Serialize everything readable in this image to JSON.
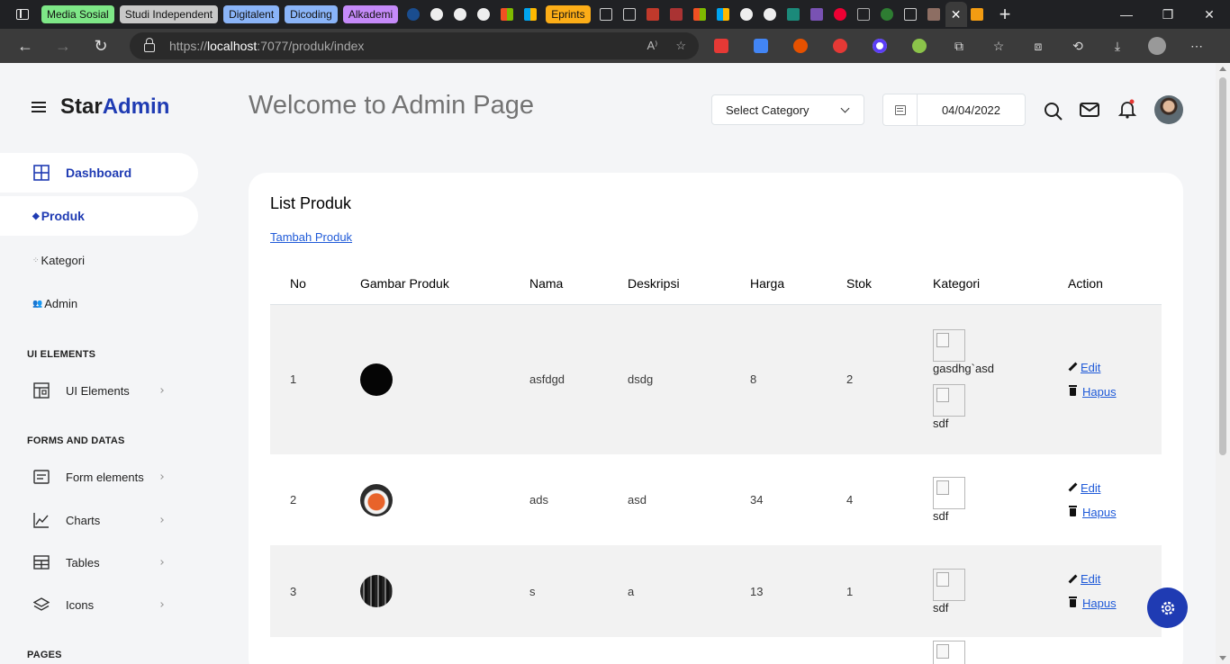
{
  "browser": {
    "tab_groups": [
      {
        "label": "Media Sosial",
        "color": "#7ee787"
      },
      {
        "label": "Studi Independent",
        "color": "#c8c8c8"
      },
      {
        "label": "Digitalent",
        "color": "#8ab4f8"
      },
      {
        "label": "Dicoding",
        "color": "#8ab4f8"
      },
      {
        "label": "Alkademi",
        "color": "#c58af9"
      },
      {
        "label": "Eprints",
        "color": "#fcad17"
      }
    ],
    "url_scheme": "https://",
    "url_host": "localhost",
    "url_rest": ":7077/produk/index"
  },
  "header": {
    "brand_star": "Star",
    "brand_admin": "Admin",
    "welcome": "Welcome to Admin Page",
    "category_select": "Select Category",
    "date": "04/04/2022"
  },
  "sidebar": {
    "dashboard": "Dashboard",
    "produk": "Produk",
    "kategori": "Kategori",
    "admin": "Admin",
    "section_ui": "UI ELEMENTS",
    "ui_elements": "UI Elements",
    "section_forms": "FORMS AND DATAS",
    "form_elements": "Form elements",
    "charts": "Charts",
    "tables": "Tables",
    "icons": "Icons",
    "section_pages": "PAGES"
  },
  "card": {
    "title": "List Produk",
    "add_link": "Tambah Produk",
    "columns": [
      "No",
      "Gambar Produk",
      "Nama",
      "Deskripsi",
      "Harga",
      "Stok",
      "Kategori",
      "Action"
    ],
    "rows": [
      {
        "no": "1",
        "nama": "asfdgd",
        "deskripsi": "dsdg",
        "harga": "8",
        "stok": "2",
        "kategori": [
          "gasdhg`asd",
          "sdf"
        ]
      },
      {
        "no": "2",
        "nama": "ads",
        "deskripsi": "asd",
        "harga": "34",
        "stok": "4",
        "kategori": [
          "sdf"
        ]
      },
      {
        "no": "3",
        "nama": "s",
        "deskripsi": "a",
        "harga": "13",
        "stok": "1",
        "kategori": [
          "sdf"
        ]
      }
    ],
    "edit_label": "Edit",
    "delete_label": "Hapus"
  },
  "colors": {
    "accent": "#1f3bb3",
    "link": "#1f5ad8"
  }
}
